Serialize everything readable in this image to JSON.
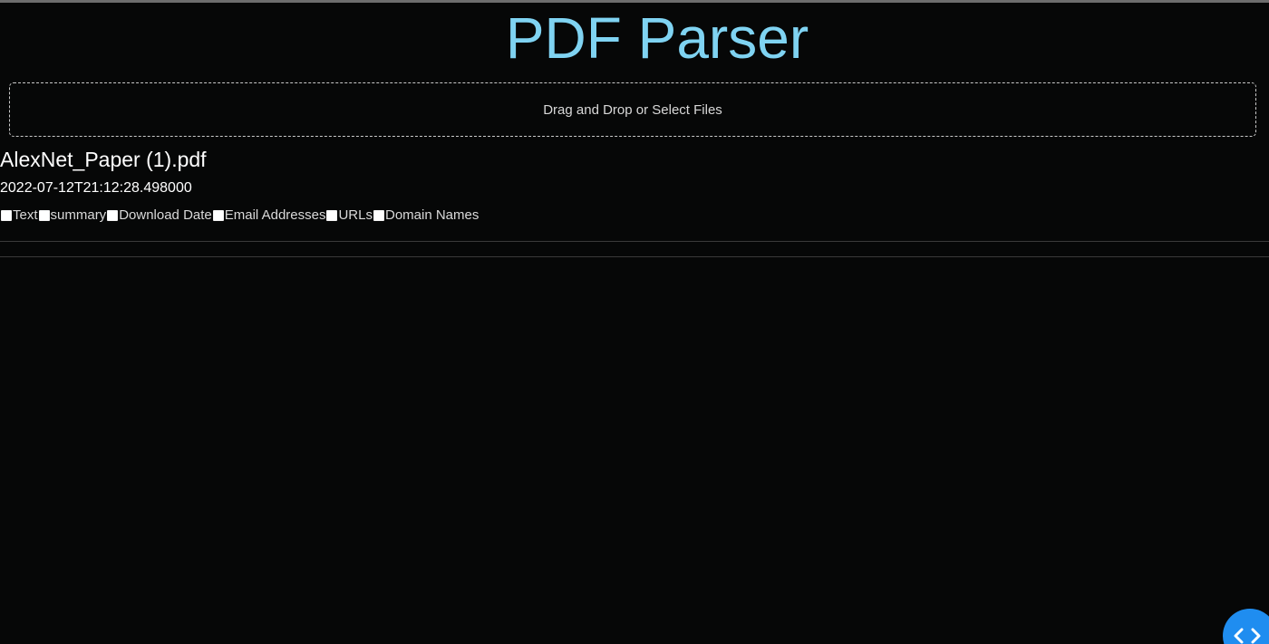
{
  "app": {
    "title": "PDF Parser"
  },
  "upload": {
    "label": "Drag and Drop or Select Files"
  },
  "file": {
    "name": "AlexNet_Paper (1).pdf",
    "timestamp": "2022-07-12T21:12:28.498000"
  },
  "options": [
    {
      "label": "Text",
      "checked": false
    },
    {
      "label": "summary",
      "checked": false
    },
    {
      "label": "Download Date",
      "checked": false
    },
    {
      "label": "Email Addresses",
      "checked": false
    },
    {
      "label": "URLs",
      "checked": false
    },
    {
      "label": "Domain Names",
      "checked": false
    }
  ],
  "fab": {
    "icon": "code-brackets-icon"
  },
  "colors": {
    "title": "#7fd3f2",
    "background": "#060707",
    "fab": "#1f8df0"
  }
}
